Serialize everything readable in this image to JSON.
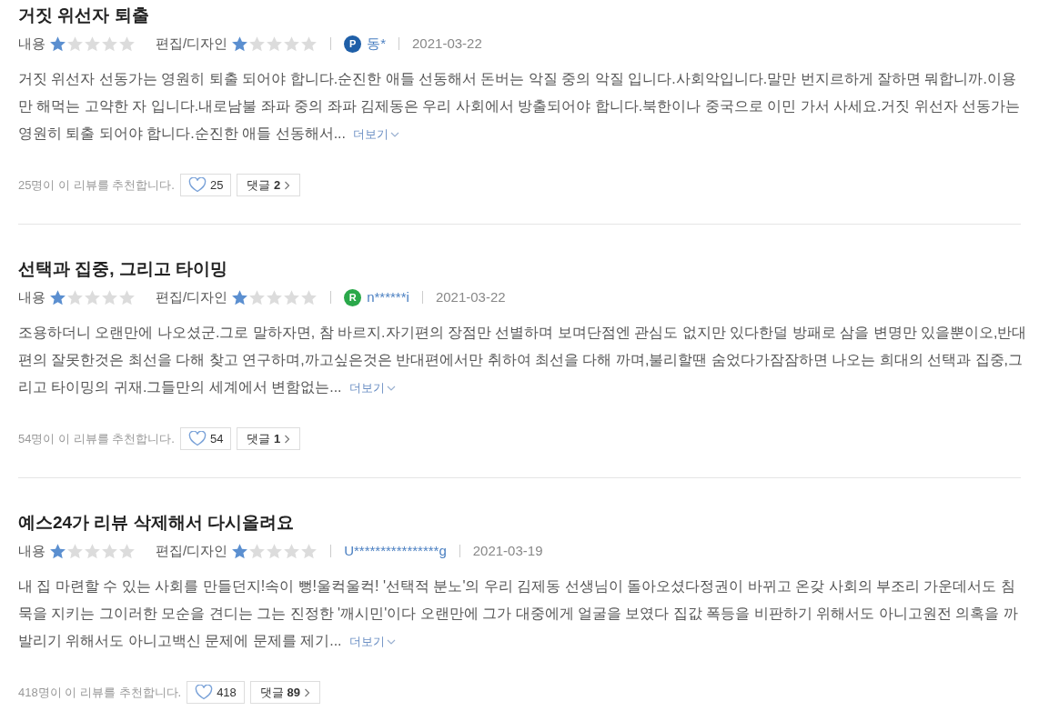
{
  "reviews": [
    {
      "title": "거짓 위선자 퇴출",
      "ratings": [
        {
          "label": "내용",
          "stars": 1
        },
        {
          "label": "편집/디자인",
          "stars": 1
        }
      ],
      "badge": {
        "letter": "P",
        "color": "#1f5fa8"
      },
      "author": "동*",
      "date": "2021-03-22",
      "body": "거짓 위선자 선동가는 영원히 퇴출 되어야 합니다.순진한 애들 선동해서 돈버는 악질 중의 악질 입니다.사회악입니다.말만 번지르하게 잘하면 뭐합니까.이용만 해먹는 고약한 자 입니다.내로남불 좌파 중의 좌파 김제동은 우리 사회에서 방출되어야 합니다.북한이나 중국으로 이민 가서 사세요.거짓 위선자 선동가는 영원히 퇴출 되어야 합니다.순진한 애들 선동해서...",
      "more": "더보기",
      "recommend_text": "25명이 이 리뷰를 추천합니다.",
      "likes": "25",
      "comments": "댓글 **2**"
    },
    {
      "title": "선택과 집중, 그리고 타이밍",
      "ratings": [
        {
          "label": "내용",
          "stars": 1
        },
        {
          "label": "편집/디자인",
          "stars": 1
        }
      ],
      "badge": {
        "letter": "R",
        "color": "#2aa84a"
      },
      "author": "n******i",
      "date": "2021-03-22",
      "body": "조용하더니 오랜만에 나오셨군.그로 말하자면, 참 바르지.자기편의 장점만 선별하며 보며단점엔 관심도 없지만 있다한덜 방패로 삼을 변명만 있을뿐이오,반대편의 잘못한것은 최선을 다해 찾고 연구하며,까고싶은것은 반대편에서만 취하여 최선을 다해 까며,불리할땐 숨었다가잠잠하면 나오는 희대의 선택과 집중,그리고 타이밍의 귀재.그들만의 세계에서 변함없는...",
      "more": "더보기",
      "recommend_text": "54명이 이 리뷰를 추천합니다.",
      "likes": "54",
      "comments": "댓글 **1**"
    },
    {
      "title": "예스24가 리뷰 삭제해서 다시올려요",
      "ratings": [
        {
          "label": "내용",
          "stars": 1
        },
        {
          "label": "편집/디자인",
          "stars": 1
        }
      ],
      "author": "U****************g",
      "date": "2021-03-19",
      "body": "내 집 마련할 수 있는 사회를 만들던지!속이 뻥!울컥울컥! '선택적 분노'의 우리 김제동 선생님이 돌아오셨다정권이 바뀌고 온갖 사회의 부조리 가운데서도 침묵을 지키는 그이러한 모순을 견디는 그는 진정한 '깨시민'이다 오랜만에 그가 대중에게 얼굴을 보였다 집값 폭등을 비판하기 위해서도 아니고원전 의혹을 까발리기 위해서도 아니고백신 문제에 문제를 제기...",
      "more": "더보기",
      "recommend_text": "418명이 이 리뷰를 추천합니다.",
      "likes": "418",
      "comments": "댓글 **89**"
    }
  ]
}
